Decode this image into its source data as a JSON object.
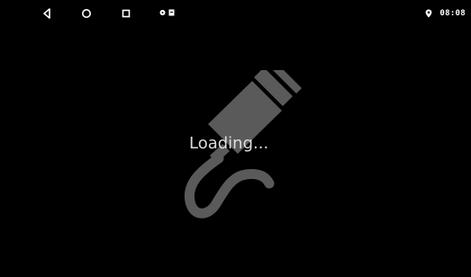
{
  "status_bar": {
    "nav_buttons": {
      "back": "back-icon",
      "home": "home-icon",
      "recents": "recents-icon"
    },
    "notification_icons": [
      "notification-icon-1",
      "notification-icon-2"
    ],
    "location_icon": "location-pin-icon",
    "clock": "08:08"
  },
  "main": {
    "graphic": "usb-plug-icon",
    "loading_text": "Loading..."
  },
  "colors": {
    "background": "#000000",
    "status_icons": "#ffffff",
    "graphic": "#5a5a5a",
    "loading_text": "#dddddd"
  }
}
